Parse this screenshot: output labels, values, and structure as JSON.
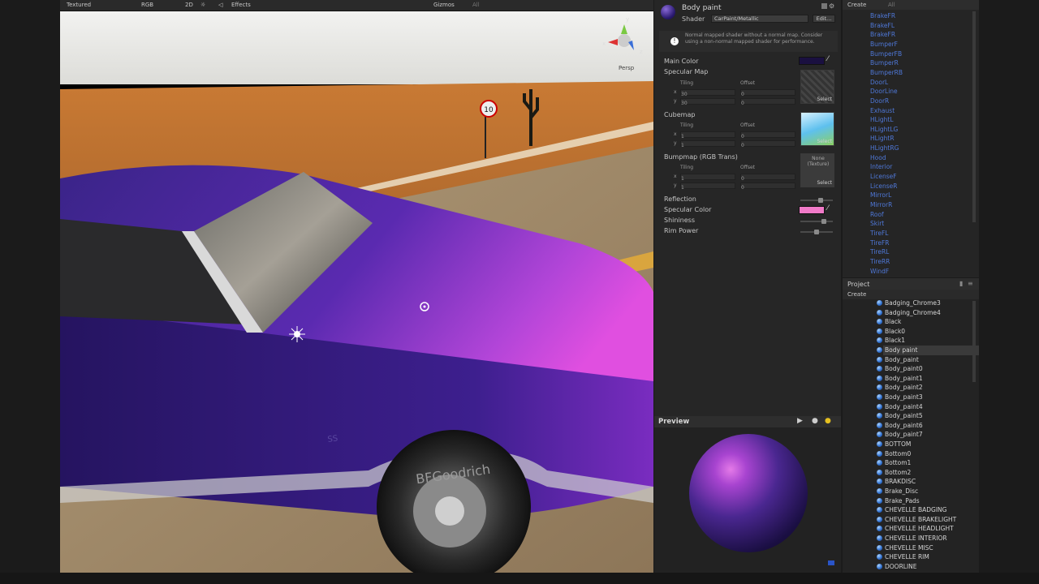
{
  "scene": {
    "toolbar": {
      "shading_mode": "Textured",
      "render_mode": "RGB",
      "twod_toggle": "2D",
      "effects": "Effects",
      "gizmos": "Gizmos",
      "search": "All"
    },
    "projection_label": "Persp",
    "speed_sign_text": "10",
    "tire_text": "BFGoodrich",
    "fender_badge": "SS"
  },
  "inspector": {
    "material_name": "Body paint",
    "shader_label": "Shader",
    "shader_value": "CarPaint/Metallic",
    "edit_button": "Edit...",
    "warning_text": "Normal mapped shader without a normal map. Consider using a non-normal mapped shader for performance.",
    "main_color_label": "Main Color",
    "main_color": "#1a1040",
    "specular_map_label": "Specular Map",
    "specular_tiling": {
      "tiling_label": "Tiling",
      "offset_label": "Offset",
      "x_label": "x",
      "y_label": "y",
      "x": "30",
      "y": "30",
      "ox": "0",
      "oy": "0"
    },
    "cubemap_label": "Cubemap",
    "cubemap_tiling": {
      "tiling_label": "Tiling",
      "offset_label": "Offset",
      "x_label": "x",
      "y_label": "y",
      "x": "1",
      "y": "1",
      "ox": "0",
      "oy": "0"
    },
    "bumpmap_label": "Bumpmap (RGB Trans)",
    "bumpmap_tiling": {
      "tiling_label": "Tiling",
      "offset_label": "Offset",
      "x_label": "x",
      "y_label": "y",
      "x": "1",
      "y": "1",
      "ox": "0",
      "oy": "0"
    },
    "bumpmap_none": "None (Texture)",
    "select_label": "Select",
    "reflection_label": "Reflection",
    "specular_color_label": "Specular Color",
    "specular_color": "#f07ac8",
    "shininess_label": "Shininess",
    "rim_power_label": "Rim Power"
  },
  "preview": {
    "title": "Preview"
  },
  "hierarchy": {
    "create_label": "Create",
    "search": "All",
    "items": [
      "BrakeFR",
      "BrakeFL",
      "BrakeFR",
      "BumperF",
      "BumperFB",
      "BumperR",
      "BumperRB",
      "DoorL",
      "DoorLine",
      "DoorR",
      "Exhaust",
      "HLightL",
      "HLightLG",
      "HLightR",
      "HLightRG",
      "Hood",
      "Interior",
      "LicenseF",
      "LicenseR",
      "MirrorL",
      "MirrorR",
      "Roof",
      "Skirt",
      "TireFL",
      "TireFR",
      "TireRL",
      "TireRR",
      "WindF"
    ]
  },
  "project": {
    "title": "Project",
    "create_label": "Create",
    "items": [
      "Badging_Chrome3",
      "Badging_Chrome4",
      "Black",
      "Black0",
      "Black1",
      "Body paint",
      "Body_paint",
      "Body_paint0",
      "Body_paint1",
      "Body_paint2",
      "Body_paint3",
      "Body_paint4",
      "Body_paint5",
      "Body_paint6",
      "Body_paint7",
      "BOTTOM",
      "Bottom0",
      "Bottom1",
      "Bottom2",
      "BRAKDISC",
      "Brake_Disc",
      "Brake_Pads",
      "CHEVELLE BADGING",
      "CHEVELLE BRAKELIGHT",
      "CHEVELLE HEADLIGHT",
      "CHEVELLE INTERIOR",
      "CHEVELLE MISC",
      "CHEVELLE RIM",
      "DOORLINE"
    ],
    "selected": "Body paint"
  }
}
